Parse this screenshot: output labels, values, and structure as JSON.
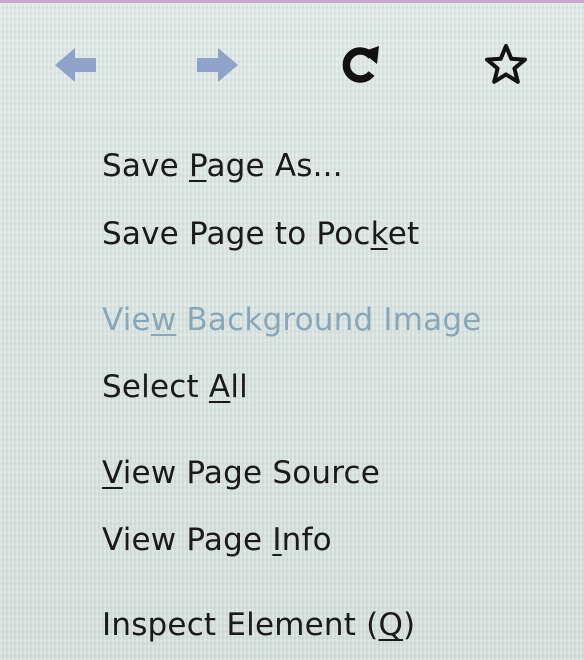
{
  "navigation": {
    "back": {
      "icon": "back-arrow-icon",
      "enabled": false
    },
    "forward": {
      "icon": "forward-arrow-icon",
      "enabled": false
    },
    "reload": {
      "icon": "reload-icon",
      "enabled": true
    },
    "bookmark": {
      "icon": "star-icon",
      "enabled": true
    }
  },
  "menu": {
    "items": [
      {
        "pre": "Save ",
        "key": "P",
        "post": "age As...",
        "enabled": true
      },
      {
        "pre": "Save Page to Poc",
        "key": "k",
        "post": "et",
        "enabled": true
      },
      {
        "pre": "Vie",
        "key": "w",
        "post": " Background Image",
        "enabled": false
      },
      {
        "pre": "Select ",
        "key": "A",
        "post": "ll",
        "enabled": true
      },
      {
        "pre": "",
        "key": "V",
        "post": "iew Page Source",
        "enabled": true
      },
      {
        "pre": "View Page ",
        "key": "I",
        "post": "nfo",
        "enabled": true
      },
      {
        "pre": "Inspect Element (",
        "key": "Q",
        "post": ")",
        "enabled": true
      }
    ]
  },
  "colors": {
    "background": "#dde7e3",
    "text": "#1a1a1a",
    "disabled_text": "#8aa7b8",
    "disabled_arrow": "#8fa3c9",
    "top_border": "#c9a9cf"
  }
}
